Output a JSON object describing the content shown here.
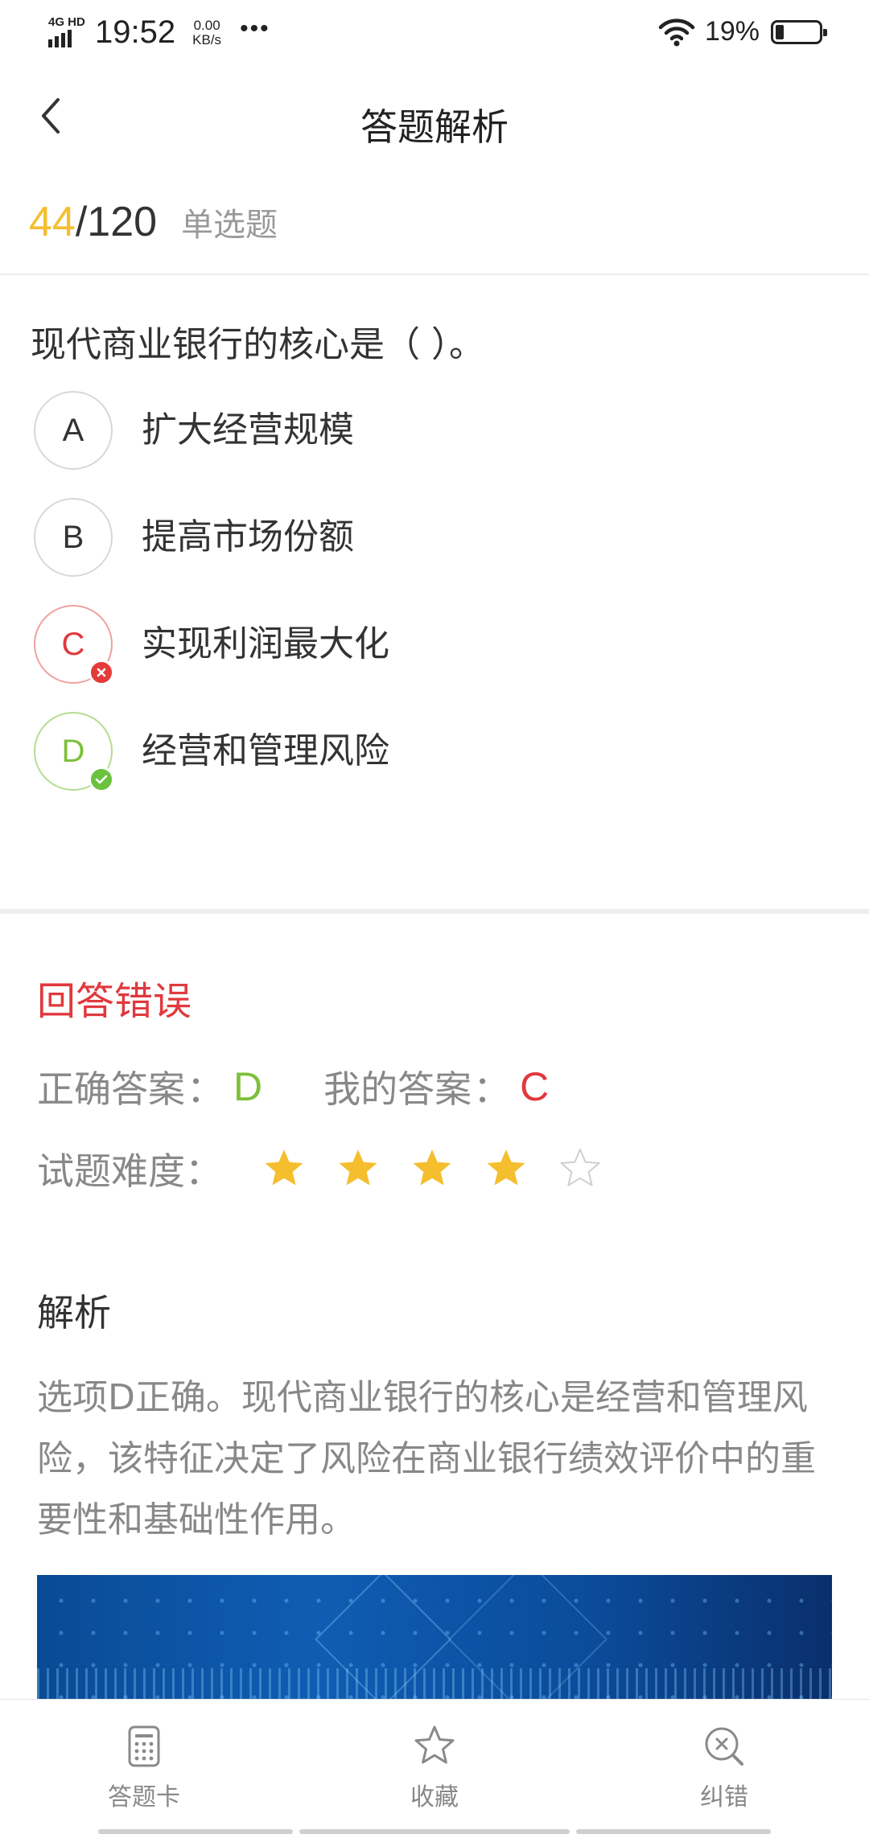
{
  "status_bar": {
    "network": "4G HD",
    "time": "19:52",
    "speed_value": "0.00",
    "speed_unit": "KB/s",
    "more": "•••",
    "battery_percent": "19%"
  },
  "header": {
    "title": "答题解析",
    "back_icon": "chevron-left-icon"
  },
  "question_meta": {
    "current": "44",
    "total": "/120",
    "type": "单选题"
  },
  "question": {
    "text": "现代商业银行的核心是（ ）。",
    "options": [
      {
        "letter": "A",
        "text": "扩大经营规模",
        "state": "normal"
      },
      {
        "letter": "B",
        "text": "提高市场份额",
        "state": "normal"
      },
      {
        "letter": "C",
        "text": "实现利润最大化",
        "state": "wrong"
      },
      {
        "letter": "D",
        "text": "经营和管理风险",
        "state": "right"
      }
    ]
  },
  "result": {
    "status": "回答错误",
    "correct_label": "正确答案",
    "correct_value": "D",
    "mine_label": "我的答案",
    "mine_value": "C",
    "colon": "：",
    "difficulty_label": "试题难度：",
    "difficulty_rating": 4,
    "difficulty_max": 5
  },
  "analysis": {
    "title": "解析",
    "text": "选项D正确。现代商业银行的核心是经营和管理风险，该特征决定了风险在商业银行绩效评价中的重要性和基础性作用。"
  },
  "bottom_nav": [
    {
      "label": "答题卡",
      "icon": "answer-sheet-icon"
    },
    {
      "label": "收藏",
      "icon": "star-outline-icon"
    },
    {
      "label": "纠错",
      "icon": "error-search-icon"
    }
  ],
  "colors": {
    "accent_yellow": "#f5be2e",
    "error_red": "#e0393e",
    "correct_green": "#7dc03a",
    "muted_text": "#888888"
  }
}
